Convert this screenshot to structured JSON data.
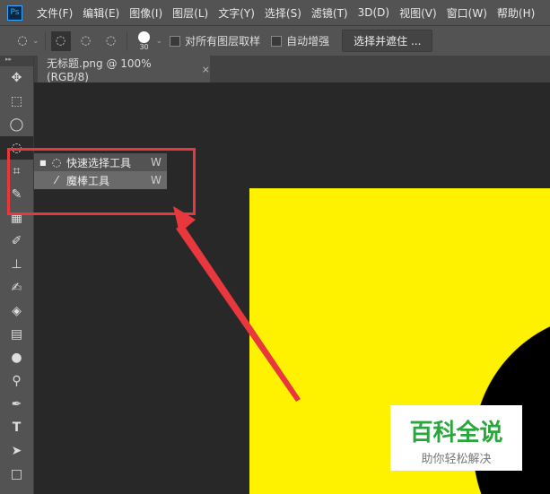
{
  "app": {
    "logo": "Ps"
  },
  "menu": [
    "文件(F)",
    "编辑(E)",
    "图像(I)",
    "图层(L)",
    "文字(Y)",
    "选择(S)",
    "滤镜(T)",
    "3D(D)",
    "视图(V)",
    "窗口(W)",
    "帮助(H)"
  ],
  "options": {
    "brush_size": "30",
    "sample_all_layers": "对所有图层取样",
    "auto_enhance": "自动增强",
    "refine_button": "选择并遮住 ..."
  },
  "document_tab": {
    "title": "无标题.png @ 100%(RGB/8)",
    "close": "×"
  },
  "flyout": [
    {
      "label": "快速选择工具",
      "shortcut": "W",
      "active": true
    },
    {
      "label": "魔棒工具",
      "shortcut": "W",
      "active": false
    }
  ],
  "watermark": {
    "title": "百科全说",
    "subtitle": "助你轻松解决"
  },
  "colors": {
    "highlight": "#e8383d",
    "canvas": "#fff200"
  }
}
